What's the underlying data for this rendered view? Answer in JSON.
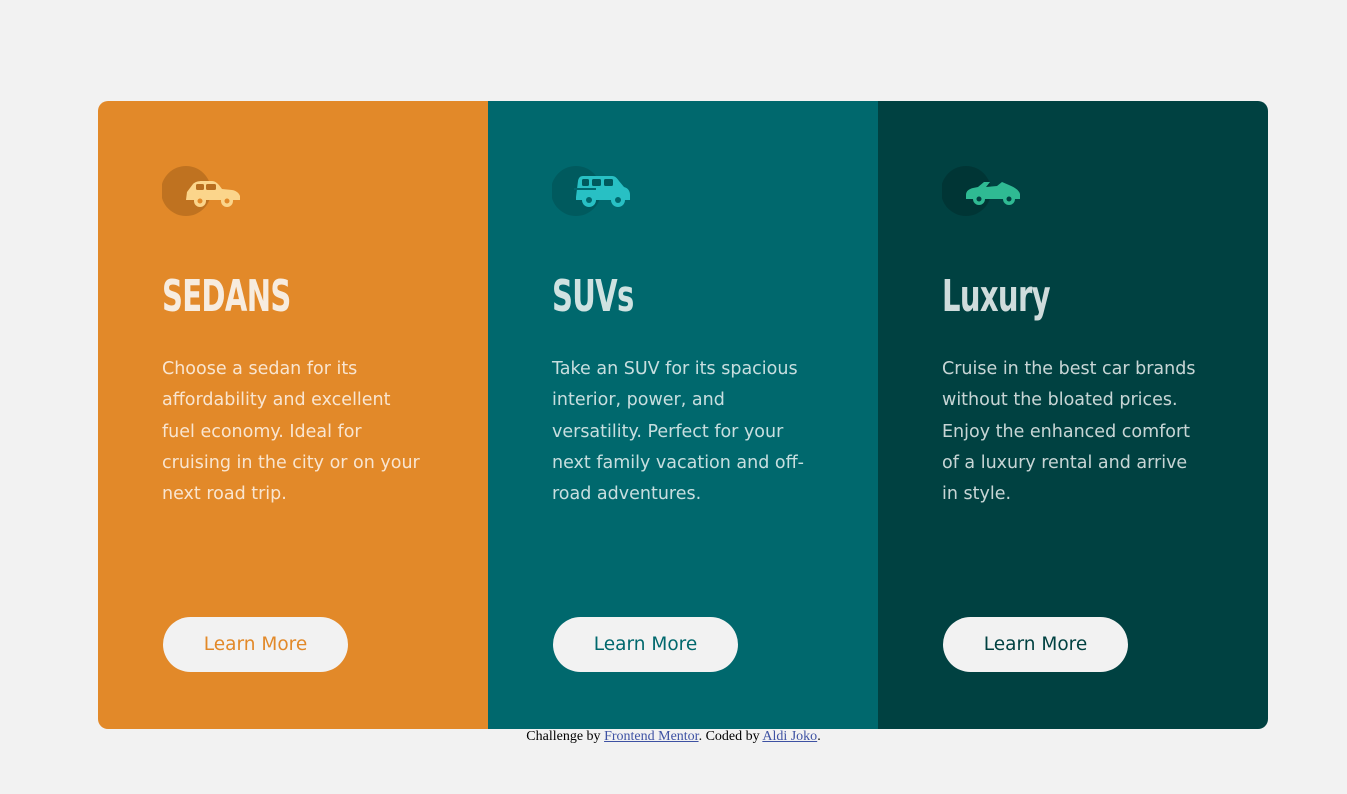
{
  "cards": [
    {
      "icon": "sedan-car-icon",
      "title": "SEDANS",
      "text": "Choose a sedan for its affordability and excellent fuel economy. Ideal for cruising in the city or on your next road trip.",
      "button": "Learn More",
      "color": "#e28929"
    },
    {
      "icon": "suv-car-icon",
      "title": "SUVs",
      "text": "Take an SUV for its spacious interior, power, and versatility. Perfect for your next family vacation and off-road adventures.",
      "button": "Learn More",
      "color": "#00686d"
    },
    {
      "icon": "luxury-car-icon",
      "title": "Luxury",
      "text": "Cruise in the best car brands without the bloated prices. Enjoy the enhanced comfort of a luxury rental and arrive in style.",
      "button": "Learn More",
      "color": "#004141"
    }
  ],
  "attribution": {
    "prefix": "Challenge by ",
    "link1": "Frontend Mentor",
    "middle": ". Coded by ",
    "link2": "Aldi Joko",
    "suffix": "."
  },
  "colors": {
    "background": "#f2f2f2",
    "sedans": "#e28929",
    "suvs": "#00686d",
    "luxury": "#004141",
    "light_text": "#f2f2f2"
  }
}
